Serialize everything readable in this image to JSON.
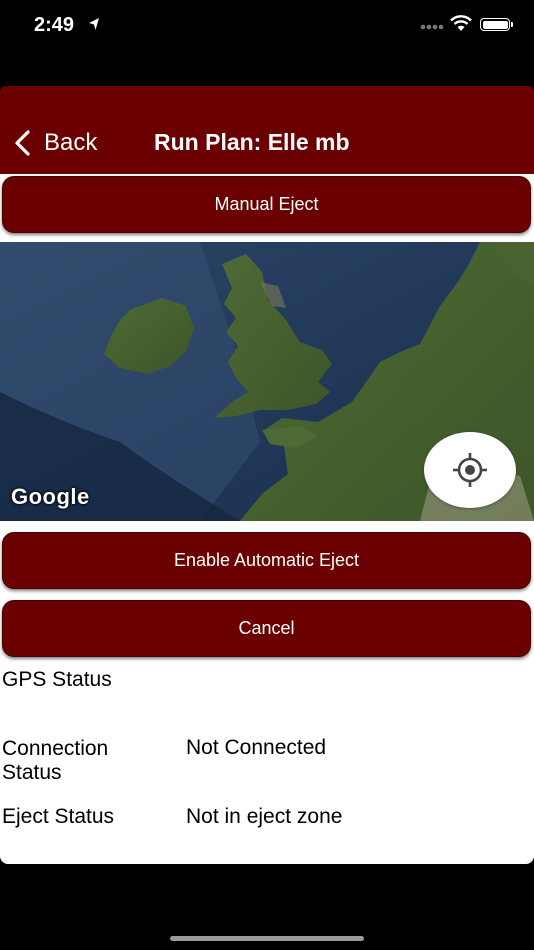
{
  "status_bar": {
    "time": "2:49"
  },
  "nav": {
    "back_label": "Back",
    "title": "Run Plan: Elle mb"
  },
  "buttons": {
    "manual_eject": "Manual Eject",
    "enable_auto_eject": "Enable Automatic Eject",
    "cancel": "Cancel"
  },
  "map": {
    "provider_logo": "Google"
  },
  "status": {
    "gps_label": "GPS Status",
    "gps_value": "",
    "connection_label_line1": "Connection",
    "connection_label_line2": "Status",
    "connection_value": "Not Connected",
    "eject_label": "Eject Status",
    "eject_value": "Not in eject zone"
  },
  "colors": {
    "primary": "#6b0000",
    "background": "#000000",
    "panel": "#ffffff"
  }
}
